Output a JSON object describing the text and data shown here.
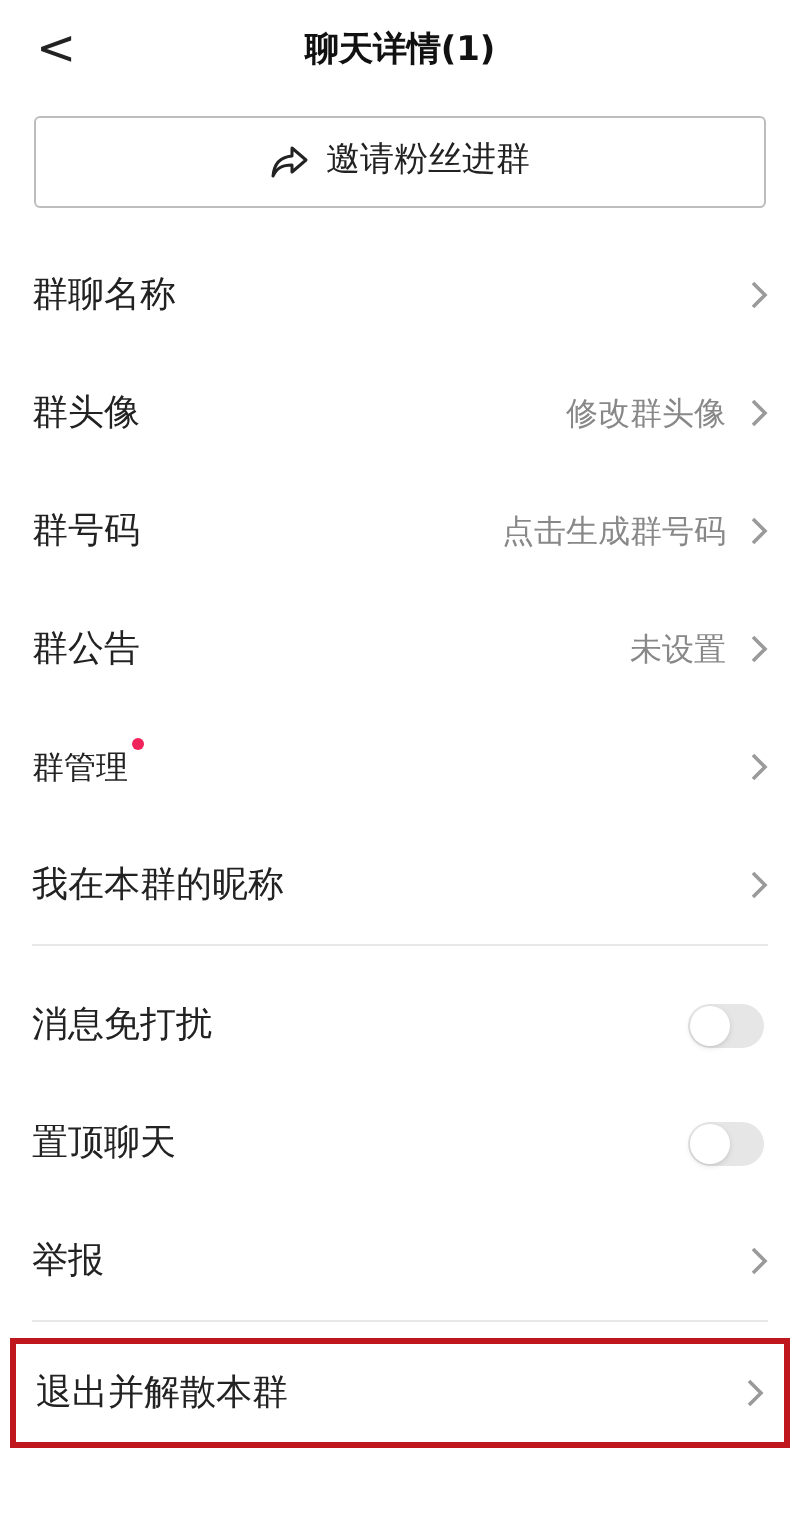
{
  "header": {
    "back": "<",
    "title": "聊天详情(1)"
  },
  "invite_button": {
    "label": "邀请粉丝进群"
  },
  "sections": [
    {
      "rows": [
        {
          "kind": "link",
          "label": "群聊名称"
        },
        {
          "kind": "link",
          "label": "群头像",
          "value": "修改群头像"
        },
        {
          "kind": "link",
          "label": "群号码",
          "value": "点击生成群号码"
        },
        {
          "kind": "link",
          "label": "群公告",
          "value": "未设置"
        },
        {
          "kind": "link",
          "label": "群管理",
          "badge": true
        },
        {
          "kind": "link",
          "label": "我在本群的昵称"
        }
      ]
    },
    {
      "rows": [
        {
          "kind": "toggle",
          "label": "消息免打扰",
          "on": false
        },
        {
          "kind": "toggle",
          "label": "置顶聊天",
          "on": false
        },
        {
          "kind": "link",
          "label": "举报"
        }
      ]
    },
    {
      "rows": [
        {
          "kind": "link",
          "label": "退出并解散本群",
          "highlighted": true
        }
      ]
    }
  ]
}
